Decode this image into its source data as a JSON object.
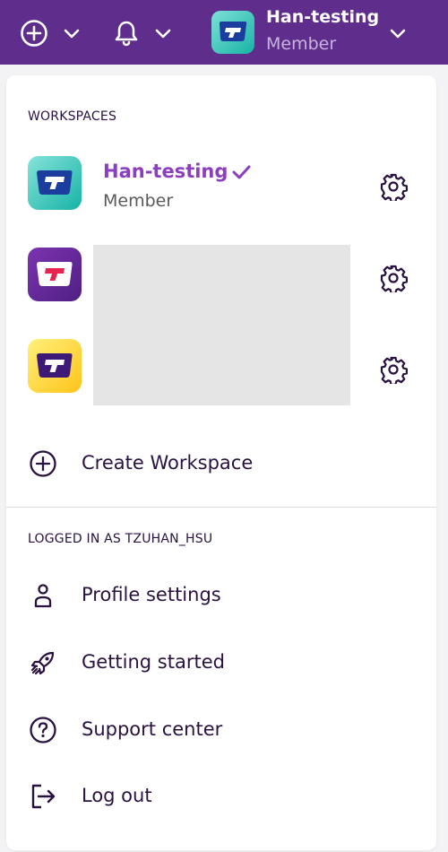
{
  "header": {
    "workspace_name": "Han-testing",
    "workspace_role": "Member",
    "icons": [
      "plus-circle-icon",
      "chevron-down-icon",
      "bell-icon",
      "chevron-down-icon",
      "workspace-logo",
      "chevron-down-icon"
    ]
  },
  "workspaces": {
    "title": "WORKSPACES",
    "items": [
      {
        "name": "Han-testing",
        "role": "Member",
        "selected": true,
        "logo_bg": "#2ec4b6",
        "logo_color": "#1b3e9e"
      },
      {
        "name": "",
        "role": "",
        "selected": false,
        "logo_bg": "#6a2c9c",
        "logo_color": "#e6244f"
      },
      {
        "name": "",
        "role": "",
        "selected": false,
        "logo_bg": "#ffd02a",
        "logo_color": "#3d1a78"
      }
    ],
    "create_label": "Create Workspace"
  },
  "account": {
    "title": "LOGGED IN AS TZUHAN_HSU",
    "items": [
      {
        "label": "Profile settings",
        "icon": "person-icon"
      },
      {
        "label": "Getting started",
        "icon": "rocket-icon"
      },
      {
        "label": "Support center",
        "icon": "question-circle-icon"
      },
      {
        "label": "Log out",
        "icon": "logout-icon"
      }
    ]
  },
  "colors": {
    "brand": "#5f2d8c",
    "accent": "#8b3fbf",
    "text": "#2a1240"
  }
}
